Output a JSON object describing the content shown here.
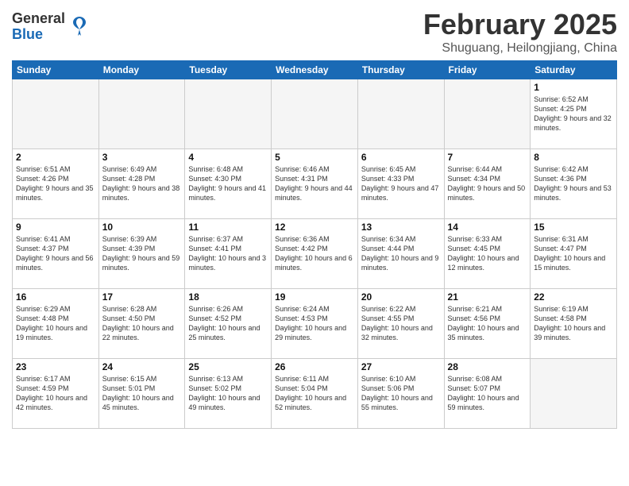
{
  "logo": {
    "general": "General",
    "blue": "Blue"
  },
  "title": "February 2025",
  "subtitle": "Shuguang, Heilongjiang, China",
  "days_of_week": [
    "Sunday",
    "Monday",
    "Tuesday",
    "Wednesday",
    "Thursday",
    "Friday",
    "Saturday"
  ],
  "weeks": [
    [
      {
        "day": "",
        "info": ""
      },
      {
        "day": "",
        "info": ""
      },
      {
        "day": "",
        "info": ""
      },
      {
        "day": "",
        "info": ""
      },
      {
        "day": "",
        "info": ""
      },
      {
        "day": "",
        "info": ""
      },
      {
        "day": "1",
        "info": "Sunrise: 6:52 AM\nSunset: 4:25 PM\nDaylight: 9 hours and 32 minutes."
      }
    ],
    [
      {
        "day": "2",
        "info": "Sunrise: 6:51 AM\nSunset: 4:26 PM\nDaylight: 9 hours and 35 minutes."
      },
      {
        "day": "3",
        "info": "Sunrise: 6:49 AM\nSunset: 4:28 PM\nDaylight: 9 hours and 38 minutes."
      },
      {
        "day": "4",
        "info": "Sunrise: 6:48 AM\nSunset: 4:30 PM\nDaylight: 9 hours and 41 minutes."
      },
      {
        "day": "5",
        "info": "Sunrise: 6:46 AM\nSunset: 4:31 PM\nDaylight: 9 hours and 44 minutes."
      },
      {
        "day": "6",
        "info": "Sunrise: 6:45 AM\nSunset: 4:33 PM\nDaylight: 9 hours and 47 minutes."
      },
      {
        "day": "7",
        "info": "Sunrise: 6:44 AM\nSunset: 4:34 PM\nDaylight: 9 hours and 50 minutes."
      },
      {
        "day": "8",
        "info": "Sunrise: 6:42 AM\nSunset: 4:36 PM\nDaylight: 9 hours and 53 minutes."
      }
    ],
    [
      {
        "day": "9",
        "info": "Sunrise: 6:41 AM\nSunset: 4:37 PM\nDaylight: 9 hours and 56 minutes."
      },
      {
        "day": "10",
        "info": "Sunrise: 6:39 AM\nSunset: 4:39 PM\nDaylight: 9 hours and 59 minutes."
      },
      {
        "day": "11",
        "info": "Sunrise: 6:37 AM\nSunset: 4:41 PM\nDaylight: 10 hours and 3 minutes."
      },
      {
        "day": "12",
        "info": "Sunrise: 6:36 AM\nSunset: 4:42 PM\nDaylight: 10 hours and 6 minutes."
      },
      {
        "day": "13",
        "info": "Sunrise: 6:34 AM\nSunset: 4:44 PM\nDaylight: 10 hours and 9 minutes."
      },
      {
        "day": "14",
        "info": "Sunrise: 6:33 AM\nSunset: 4:45 PM\nDaylight: 10 hours and 12 minutes."
      },
      {
        "day": "15",
        "info": "Sunrise: 6:31 AM\nSunset: 4:47 PM\nDaylight: 10 hours and 15 minutes."
      }
    ],
    [
      {
        "day": "16",
        "info": "Sunrise: 6:29 AM\nSunset: 4:48 PM\nDaylight: 10 hours and 19 minutes."
      },
      {
        "day": "17",
        "info": "Sunrise: 6:28 AM\nSunset: 4:50 PM\nDaylight: 10 hours and 22 minutes."
      },
      {
        "day": "18",
        "info": "Sunrise: 6:26 AM\nSunset: 4:52 PM\nDaylight: 10 hours and 25 minutes."
      },
      {
        "day": "19",
        "info": "Sunrise: 6:24 AM\nSunset: 4:53 PM\nDaylight: 10 hours and 29 minutes."
      },
      {
        "day": "20",
        "info": "Sunrise: 6:22 AM\nSunset: 4:55 PM\nDaylight: 10 hours and 32 minutes."
      },
      {
        "day": "21",
        "info": "Sunrise: 6:21 AM\nSunset: 4:56 PM\nDaylight: 10 hours and 35 minutes."
      },
      {
        "day": "22",
        "info": "Sunrise: 6:19 AM\nSunset: 4:58 PM\nDaylight: 10 hours and 39 minutes."
      }
    ],
    [
      {
        "day": "23",
        "info": "Sunrise: 6:17 AM\nSunset: 4:59 PM\nDaylight: 10 hours and 42 minutes."
      },
      {
        "day": "24",
        "info": "Sunrise: 6:15 AM\nSunset: 5:01 PM\nDaylight: 10 hours and 45 minutes."
      },
      {
        "day": "25",
        "info": "Sunrise: 6:13 AM\nSunset: 5:02 PM\nDaylight: 10 hours and 49 minutes."
      },
      {
        "day": "26",
        "info": "Sunrise: 6:11 AM\nSunset: 5:04 PM\nDaylight: 10 hours and 52 minutes."
      },
      {
        "day": "27",
        "info": "Sunrise: 6:10 AM\nSunset: 5:06 PM\nDaylight: 10 hours and 55 minutes."
      },
      {
        "day": "28",
        "info": "Sunrise: 6:08 AM\nSunset: 5:07 PM\nDaylight: 10 hours and 59 minutes."
      },
      {
        "day": "",
        "info": ""
      }
    ]
  ]
}
